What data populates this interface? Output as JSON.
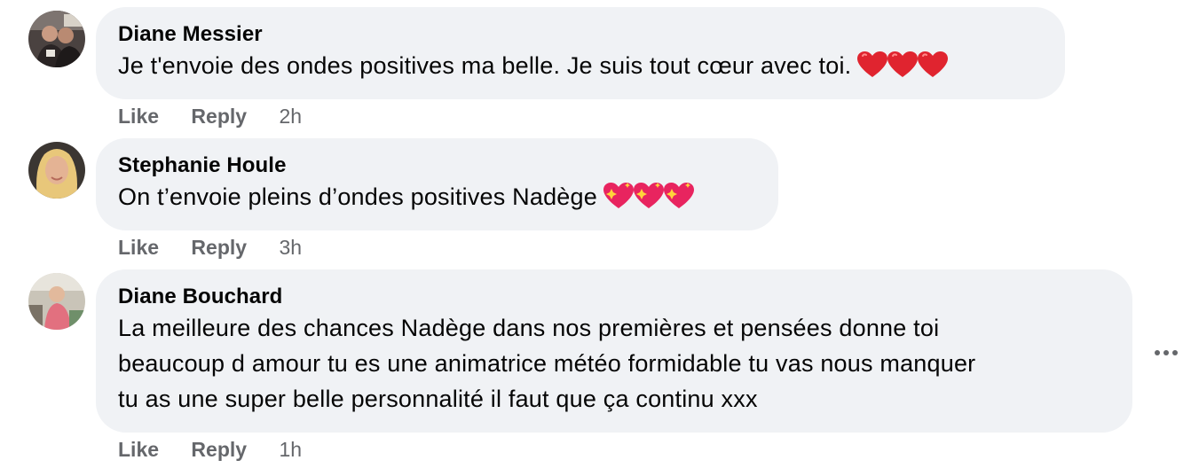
{
  "comments": [
    {
      "author": "Diane Messier",
      "text": "Je t'envoie des ondes positives ma belle. Je suis tout cœur avec toi.",
      "emoji": "red-heart",
      "emoji_count": 3,
      "like_label": "Like",
      "reply_label": "Reply",
      "time": "2h"
    },
    {
      "author": "Stephanie Houle",
      "text": "On t’envoie pleins d’ondes positives Nadège",
      "emoji": "sparkling-heart",
      "emoji_count": 3,
      "like_label": "Like",
      "reply_label": "Reply",
      "time": "3h"
    },
    {
      "author": "Diane Bouchard",
      "text_lines": [
        "La meilleure des chances Nadège dans nos premières et pensées donne toi",
        "beaucoup d amour tu es une animatrice météo formidable tu vas nous manquer",
        "tu as une super belle personnalité il faut que ça continu xxx"
      ],
      "like_label": "Like",
      "reply_label": "Reply",
      "time": "1h"
    }
  ],
  "more_options_icon": "ellipsis-icon",
  "colors": {
    "bubble": "#f0f2f5",
    "meta_text": "#65676b",
    "heart_red": "#e0242f",
    "sparkle_heart": "#e8245f"
  }
}
